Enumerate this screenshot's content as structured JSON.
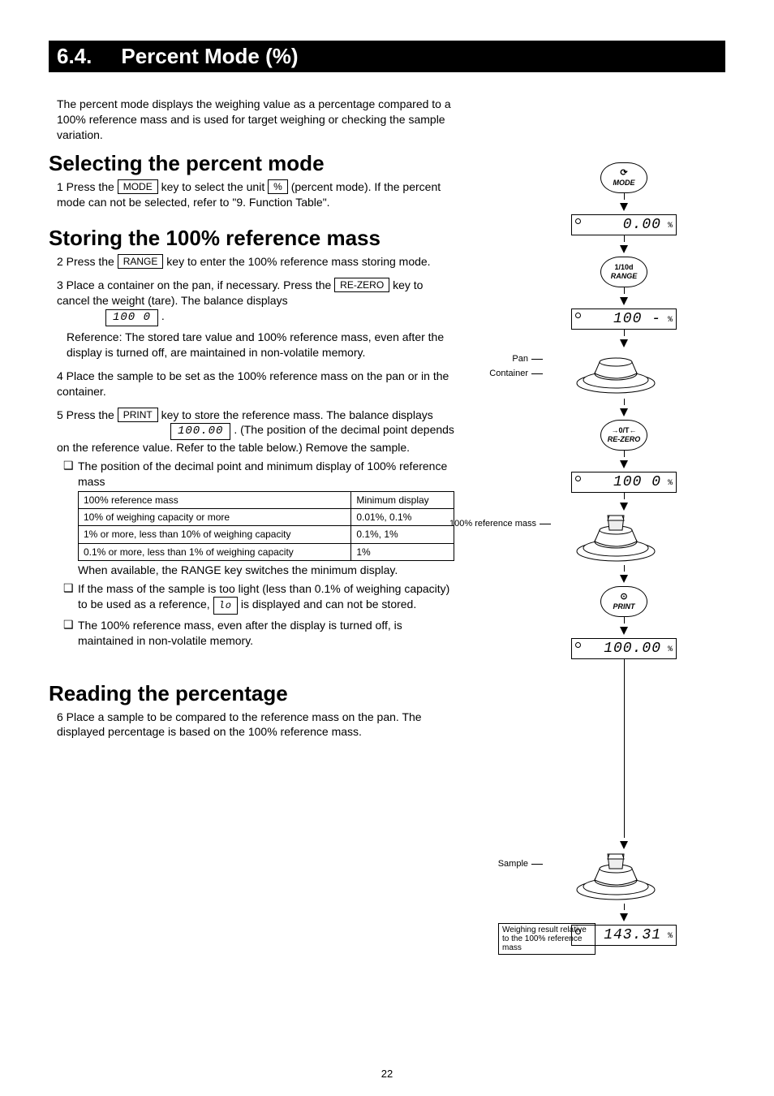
{
  "section": {
    "num": "6.4.",
    "title": "Percent Mode (%)"
  },
  "intro": "The percent mode displays the weighing value as a percentage compared to a 100% reference mass and is used for target weighing or checking the sample variation.",
  "sel": {
    "heading": "Selecting the percent mode",
    "step1_a": "1 Press the ",
    "step1_b": " key to select the unit ",
    "step1_c": " (percent mode). If the percent mode can not be selected, refer to \"9. Function Table\".",
    "key_mode": "MODE",
    "key_pct": "%"
  },
  "store": {
    "heading": "Storing the 100% reference mass",
    "s2_a": "2 Press the ",
    "s2_b": " key to enter the 100% reference mass storing mode.",
    "key_range": "RANGE",
    "s3_a": "3 Place a container on the pan, if necessary. Press the ",
    "s3_b": " key to cancel the weight (tare). The balance displays ",
    "s3_c": ".",
    "key_rezero": "RE-ZERO",
    "s3_ref": "Reference: The stored tare value and 100% reference mass, even after the display is turned off, are maintained in non-volatile memory.",
    "disp_100_0": "100  0",
    "s4_a": "4 Place the sample to be set as the 100% reference mass on the pan or in the container.",
    "s5_a": "5 Press the ",
    "s5_b": " key to store the reference mass. The balance displays ",
    "s5_c": ". (The position of the decimal point depends on the reference value. Refer to the table below.) Remove the sample.",
    "key_print": "PRINT",
    "disp_10000": "100.00",
    "note1_a": "The position of the decimal point and minimum display of 100% reference mass ",
    "note1_b": "When available, the RANGE key switches the minimum display.",
    "table": {
      "h1": "100% reference mass",
      "h2": "Minimum display",
      "r1a": "10% of weighing capacity or more",
      "r1b": "0.01%, 0.1%",
      "r2a": "1% or more, less than 10% of weighing capacity",
      "r2b": "0.1%, 1%",
      "r3a": "0.1% or more, less than 1% of weighing capacity",
      "r3b": "1%"
    },
    "note2_a": "If the mass of the sample is too light (less than 0.1% of weighing capacity) to be used as a reference, ",
    "note2_b": " is displayed and can not be stored.",
    "disp_lo": "lo",
    "note3": "The 100% reference mass, even after the display is turned off, is maintained in non-volatile memory."
  },
  "read": {
    "heading": "Reading the percentage",
    "s6": "6 Place a sample to be compared to the reference mass on the pan. The displayed percentage is based on the 100% reference mass."
  },
  "diag": {
    "mode_sym": "⟳",
    "mode_lbl": "MODE",
    "range_top": "1/10d",
    "range_lbl": "RANGE",
    "rezero_sym": "→0/T←",
    "rezero_lbl": "RE-ZERO",
    "print_sym": "⊙",
    "print_lbl": "PRINT",
    "lcd_000": "0.00",
    "lcd_100dash": "100  -",
    "lcd_100_0": "100  0",
    "lcd_10000": "100.00",
    "lcd_14331": "143.31",
    "pct": "%",
    "pan_label": "Pan",
    "container_label": "Container",
    "ref_label": "100% reference mass",
    "sample_label": "Sample",
    "result_label": "Weighing result relative to the 100% reference mass"
  },
  "page_num": "22"
}
